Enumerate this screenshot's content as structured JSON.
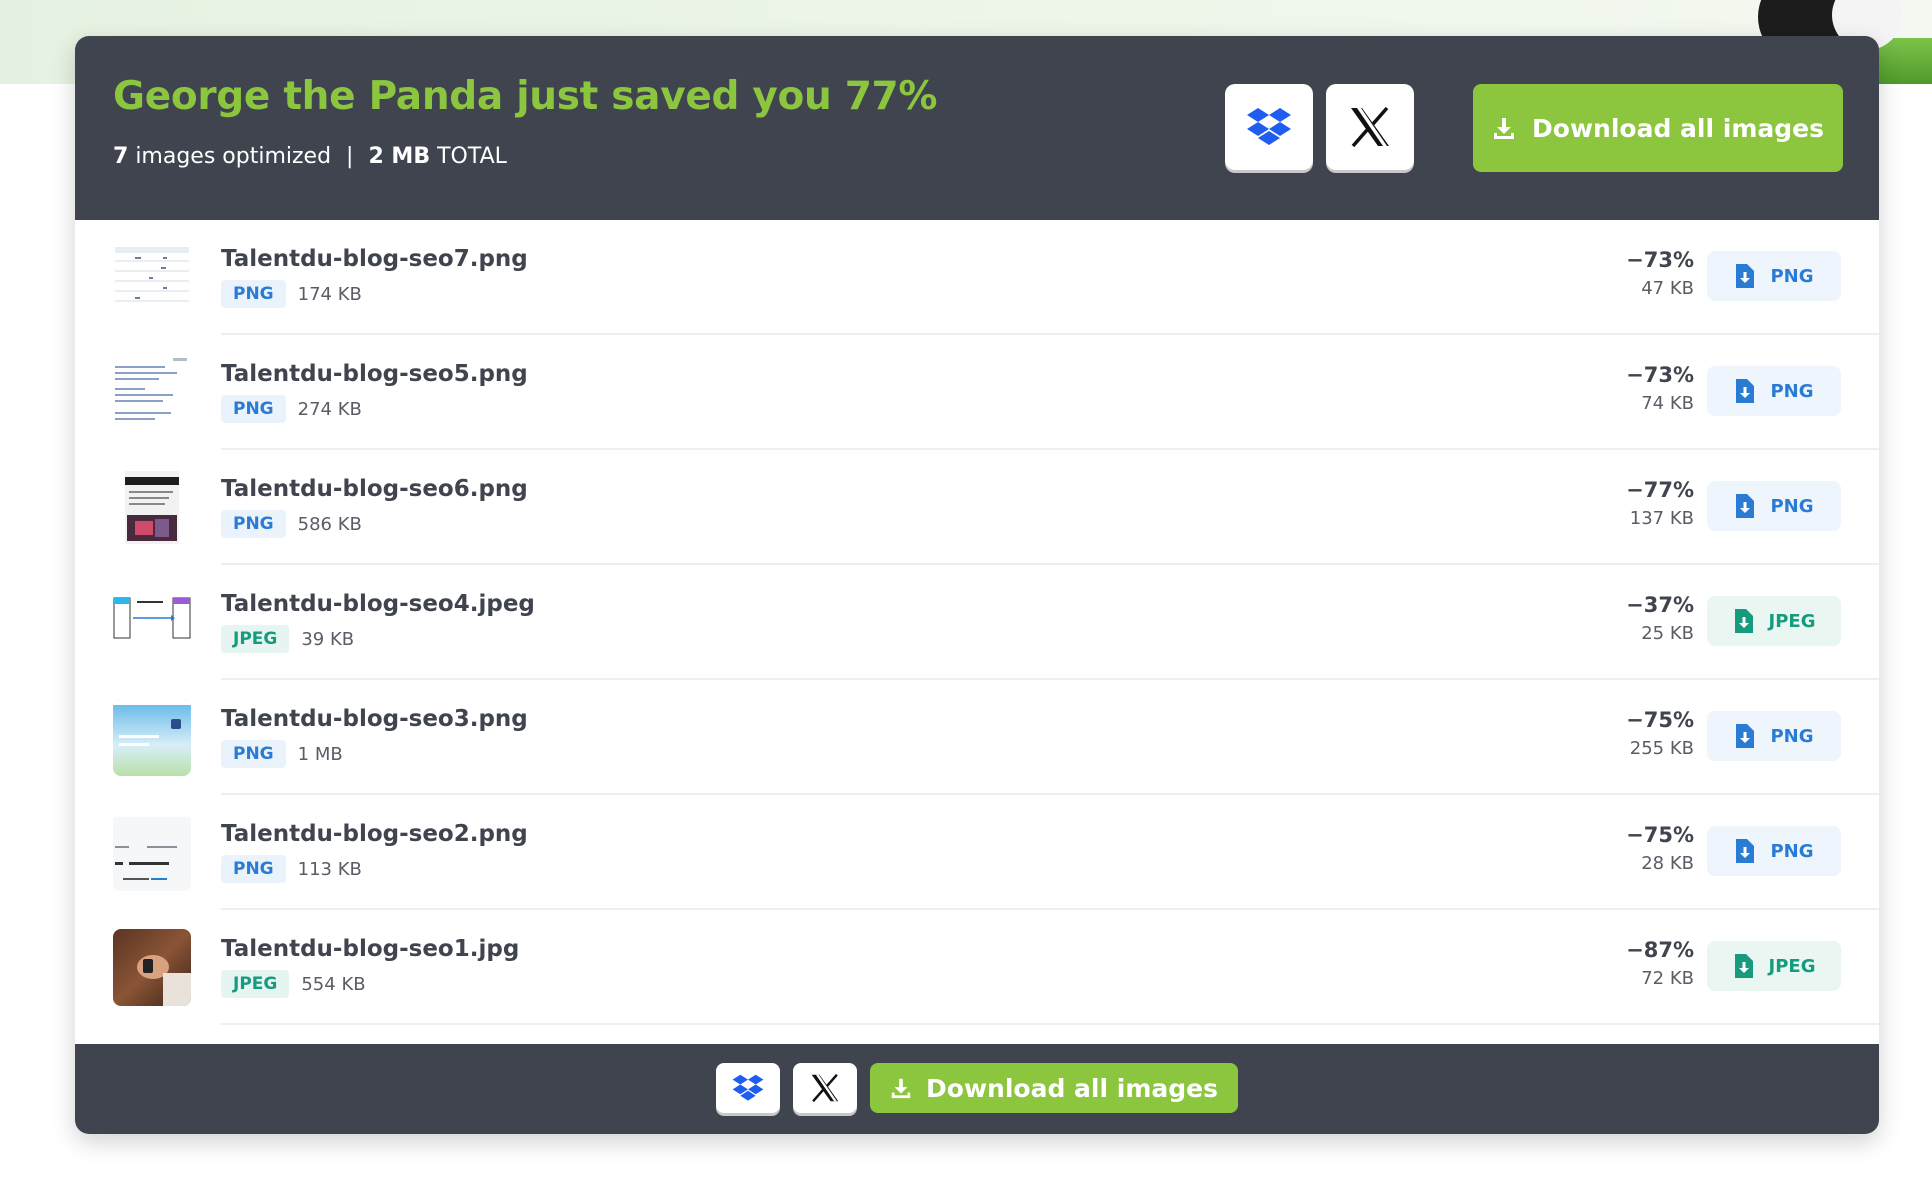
{
  "header": {
    "headline": "George the Panda just saved you 77%",
    "count": "7",
    "count_label": "images optimized",
    "separator": "|",
    "total": "2 MB",
    "total_label": "TOTAL",
    "download_all_label": "Download all images",
    "dropbox_icon": "dropbox-icon",
    "x_icon": "x-logo-icon"
  },
  "colors": {
    "accent_green": "#8cc63f",
    "header_bg": "#40444f",
    "png_blue": "#2a7bd4",
    "jpeg_teal": "#169b7f"
  },
  "files": [
    {
      "name": "Talentdu-blog-seo7.png",
      "type": "PNG",
      "size": "174 KB",
      "saved": "−73%",
      "new_size": "47 KB",
      "download_label": "PNG"
    },
    {
      "name": "Talentdu-blog-seo5.png",
      "type": "PNG",
      "size": "274 KB",
      "saved": "−73%",
      "new_size": "74 KB",
      "download_label": "PNG"
    },
    {
      "name": "Talentdu-blog-seo6.png",
      "type": "PNG",
      "size": "586 KB",
      "saved": "−77%",
      "new_size": "137 KB",
      "download_label": "PNG"
    },
    {
      "name": "Talentdu-blog-seo4.jpeg",
      "type": "JPEG",
      "size": "39 KB",
      "saved": "−37%",
      "new_size": "25 KB",
      "download_label": "JPEG"
    },
    {
      "name": "Talentdu-blog-seo3.png",
      "type": "PNG",
      "size": "1 MB",
      "saved": "−75%",
      "new_size": "255 KB",
      "download_label": "PNG"
    },
    {
      "name": "Talentdu-blog-seo2.png",
      "type": "PNG",
      "size": "113 KB",
      "saved": "−75%",
      "new_size": "28 KB",
      "download_label": "PNG"
    },
    {
      "name": "Talentdu-blog-seo1.jpg",
      "type": "JPEG",
      "size": "554 KB",
      "saved": "−87%",
      "new_size": "72 KB",
      "download_label": "JPEG"
    }
  ],
  "footer": {
    "download_all_label": "Download all images"
  }
}
